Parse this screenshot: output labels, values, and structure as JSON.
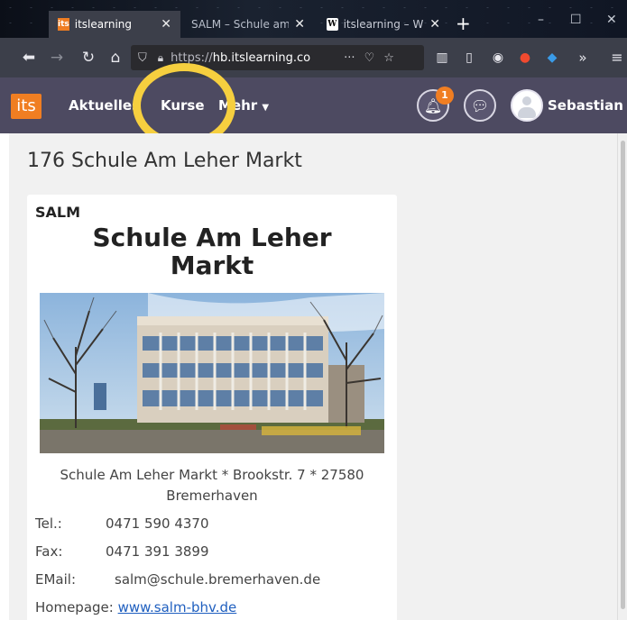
{
  "browser": {
    "tabs": [
      {
        "label": "itslearning",
        "favicon": "its"
      },
      {
        "label": "SALM – Schule am L",
        "favicon": "none"
      },
      {
        "label": "itslearning – Wi",
        "favicon": "W"
      }
    ],
    "new_tab_icon": "+",
    "url_host": "hb.itslearning.co",
    "url_prefix": "https://",
    "icons": [
      "back-arrow",
      "forward-arrow",
      "reload",
      "home",
      "shield",
      "lock",
      "more",
      "pocket",
      "star",
      "library",
      "sidebar",
      "account",
      "ext-1",
      "ext-2",
      "overflow",
      "menu"
    ]
  },
  "header": {
    "logo": "its",
    "nav": {
      "aktuelles": "Aktuelles",
      "kurse": "Kurse",
      "mehr": "Mehr"
    },
    "notification_count": "1",
    "username": "Sebastian",
    "highlight_color": "#f6cf3f"
  },
  "page": {
    "title": "176 Schule Am Leher Markt",
    "card": {
      "abbr": "SALM",
      "name_line1": "Schule Am Leher",
      "name_line2": "Markt",
      "address_line1": "Schule Am Leher Markt * Brookstr. 7 * 27580",
      "address_line2": "Bremerhaven",
      "tel_label": "Tel.:",
      "tel_value": "0471 590 4370",
      "fax_label": "Fax:",
      "fax_value": "0471 391 3899",
      "email_label": "EMail:",
      "email_value": "salm@schule.bremerhaven.de",
      "homepage_label": "Homepage:",
      "homepage_value": "www.salm-bhv.de"
    }
  },
  "colors": {
    "its_orange": "#f07e22",
    "header_bg": "#4d4a61",
    "link": "#1f5fbf"
  }
}
